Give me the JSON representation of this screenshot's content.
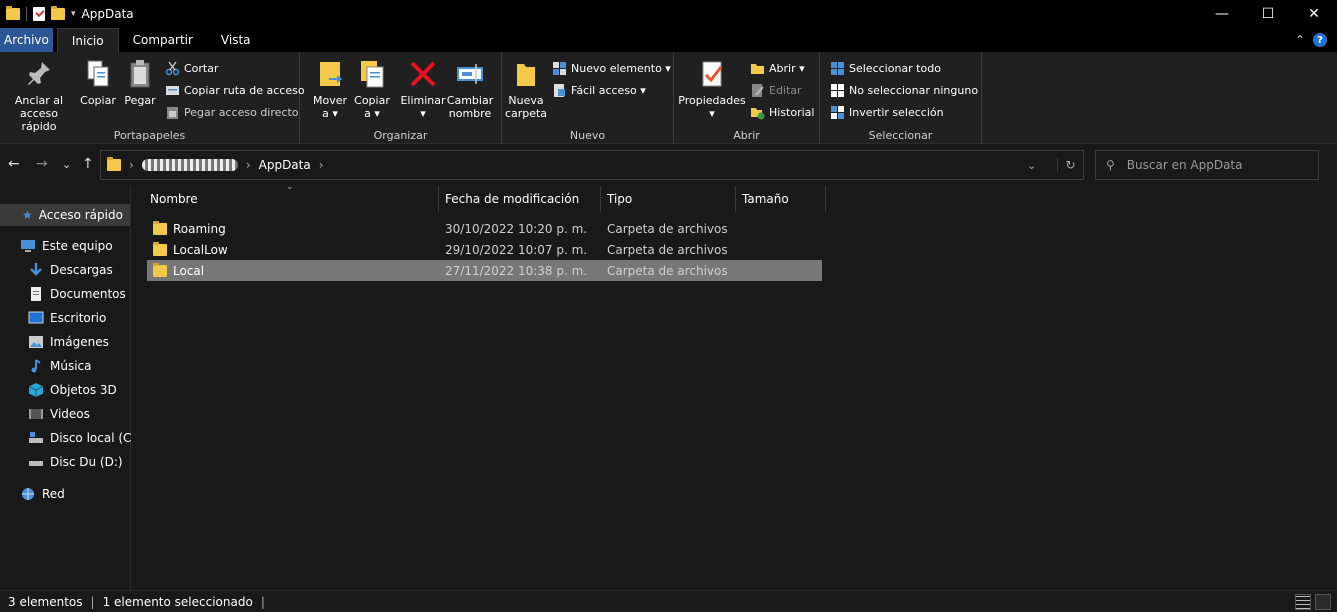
{
  "window": {
    "title": "AppData",
    "minimize": "—",
    "maximize": "☐",
    "close": "✕"
  },
  "tabs": {
    "file": "Archivo",
    "home": "Inicio",
    "share": "Compartir",
    "view": "Vista",
    "help": "?"
  },
  "ribbon": {
    "clipboard": {
      "label": "Portapapeles",
      "pin_1": "Anclar al",
      "pin_2": "acceso rápido",
      "copy": "Copiar",
      "paste": "Pegar",
      "cut": "Cortar",
      "copy_path": "Copiar ruta de acceso",
      "paste_shortcut": "Pegar acceso directo"
    },
    "organize": {
      "label": "Organizar",
      "move_1": "Mover",
      "move_2": "a ▾",
      "copyto_1": "Copiar",
      "copyto_2": "a ▾",
      "delete_1": "Eliminar",
      "delete_2": "▾",
      "rename_1": "Cambiar",
      "rename_2": "nombre"
    },
    "new": {
      "label": "Nuevo",
      "folder_1": "Nueva",
      "folder_2": "carpeta",
      "new_item": "Nuevo elemento ▾",
      "easy_access": "Fácil acceso ▾"
    },
    "open": {
      "label": "Abrir",
      "props_1": "Propiedades",
      "props_2": "▾",
      "open": "Abrir ▾",
      "edit": "Editar",
      "history": "Historial"
    },
    "select": {
      "label": "Seleccionar",
      "all": "Seleccionar todo",
      "none": "No seleccionar ninguno",
      "invert": "Invertir selección"
    }
  },
  "address": {
    "back": "←",
    "forward": "→",
    "recent": "⌄",
    "up": "↑",
    "current": "AppData",
    "sep": "›",
    "dropdown": "⌄",
    "refresh": "↻"
  },
  "search": {
    "icon": "⚲",
    "placeholder": "Buscar en AppData"
  },
  "sidebar": {
    "quick": "Acceso rápido",
    "pc": "Este equipo",
    "downloads": "Descargas",
    "documents": "Documentos",
    "desktop": "Escritorio",
    "pictures": "Imágenes",
    "music": "Música",
    "objects3d": "Objetos 3D",
    "videos": "Videos",
    "diskc": "Disco local (C:)",
    "diskd": "Disc Du (D:)",
    "network": "Red"
  },
  "columns": {
    "name": "Nombre",
    "date": "Fecha de modificación",
    "type": "Tipo",
    "size": "Tamaño"
  },
  "files": [
    {
      "name": "Roaming",
      "date": "30/10/2022 10:20 p. m.",
      "type": "Carpeta de archivos"
    },
    {
      "name": "LocalLow",
      "date": "29/10/2022 10:07 p. m.",
      "type": "Carpeta de archivos"
    },
    {
      "name": "Local",
      "date": "27/11/2022 10:38 p. m.",
      "type": "Carpeta de archivos"
    }
  ],
  "status": {
    "count": "3 elementos",
    "selected": "1 elemento seleccionado",
    "sep": "|"
  },
  "colors": {
    "accent": "#2b5797",
    "folder": "#f3c94a",
    "selection": "#777777",
    "background": "#191919"
  }
}
